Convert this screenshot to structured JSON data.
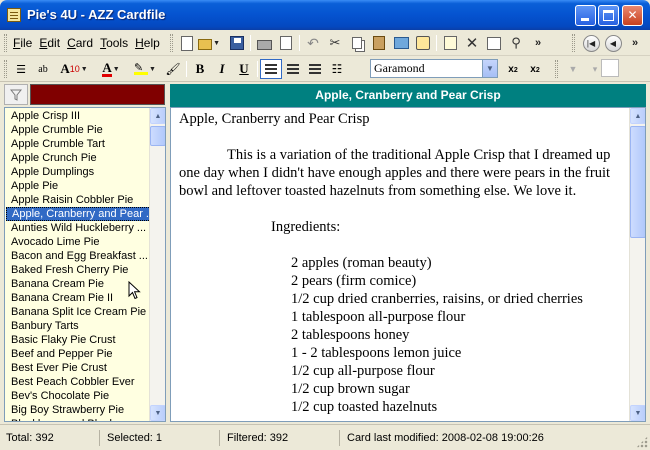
{
  "window": {
    "title": "Pie's 4U - AZZ Cardfile"
  },
  "menu": [
    "File",
    "Edit",
    "Card",
    "Tools",
    "Help"
  ],
  "toolbar": {
    "font_name": "Garamond",
    "font_size": "10",
    "more_glyph": "»"
  },
  "card_list": {
    "items": [
      "Apple Crisp III",
      "Apple Crumble Pie",
      "Apple Crumble Tart",
      "Apple Crunch Pie",
      "Apple Dumplings",
      "Apple Pie",
      "Apple Raisin Cobbler Pie",
      "Apple, Cranberry and Pear ...",
      "Aunties Wild Huckleberry ...",
      "Avocado Lime Pie",
      "Bacon and Egg Breakfast ...",
      "Baked Fresh Cherry Pie",
      "Banana Cream Pie",
      "Banana Cream Pie II",
      "Banana Split Ice Cream Pie",
      "Banbury Tarts",
      "Basic Flaky Pie Crust",
      "Beef and Pepper Pie",
      "Best Ever Pie Crust",
      "Best Peach Cobbler Ever",
      "Bev's Chocolate Pie",
      "Big Boy Strawberry Pie",
      "Blackberry and Blueberry ..."
    ],
    "selected_index": 7
  },
  "card": {
    "header": "Apple, Cranberry and Pear Crisp",
    "title_line": "Apple, Cranberry and Pear Crisp",
    "paragraph": "This is a variation of the traditional Apple Crisp that I dreamed up one day when I didn't have enough apples and there were pears in the fruit bowl and leftover toasted hazelnuts from something else. We love it.",
    "ingredients_label": "Ingredients:",
    "ingredients": [
      "2 apples (roman beauty)",
      "2 pears (firm comice)",
      "1/2 cup dried cranberries, raisins, or dried cherries",
      "1 tablespoon all-purpose flour",
      "2 tablespoons honey",
      "1 - 2 tablespoons lemon juice",
      "1/2 cup all-purpose flour",
      "1/2 cup brown sugar",
      "1/2 cup toasted hazelnuts"
    ]
  },
  "status": {
    "total": "Total: 392",
    "selected": "Selected: 1",
    "filtered": "Filtered: 392",
    "modified": "Card last modified: 2008-02-08  19:00:26"
  },
  "colors": {
    "title_blue": "#0553d0",
    "card_header_teal": "#008080",
    "list_background": "#ffffe1",
    "filter_box": "#800000",
    "selection": "#316ac5"
  }
}
